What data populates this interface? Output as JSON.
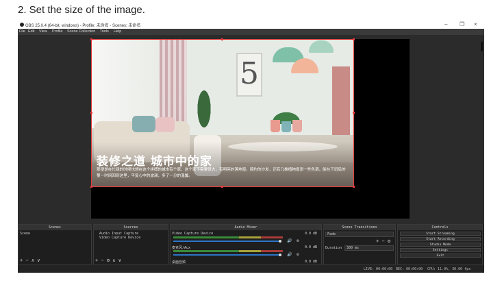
{
  "caption": "2. Set the size of the image.",
  "window": {
    "title": "OBS 25.0.4 (64-bit, windows) - Profile: 未命名 - Scenes: 未命名",
    "controls": {
      "minimize": "–",
      "maximize": "❐",
      "close": "×"
    }
  },
  "menu": [
    "File",
    "Edit",
    "View",
    "Profile",
    "Scene Collection",
    "Tools",
    "Help"
  ],
  "preview": {
    "headline": "装修之道 城市中的家",
    "description": "那便是在忙碌的时候也想在这个拼搏的城市有个家，这个家不需要很大，有明亮的落地窗，简约的沙发，还有几株植物增添一些色调，能在下班后的第一时间回到这里，平复心中的波澜，多了一分的温馨。",
    "frame_numeral": "5"
  },
  "docks": {
    "scenes": {
      "header": "Scenes",
      "items": [
        "Scene"
      ],
      "toolbar": "+ − ∧ ∨"
    },
    "sources": {
      "header": "Sources",
      "items": [
        "Audio Input Capture",
        "Video Capture Device"
      ],
      "toolbar": "+ − ⚙ ∧ ∨"
    },
    "mixer": {
      "header": "Audio Mixer",
      "channels": [
        {
          "name": "Video Capture Device",
          "db": "0.0 dB",
          "level": 0.62
        },
        {
          "name": "麦克风/Aux",
          "db": "0.0 dB",
          "level": 0.62
        },
        {
          "name": "桌面音频",
          "db": "0.0 dB",
          "level": 0.62
        }
      ]
    },
    "transitions": {
      "header": "Scene Transitions",
      "type": "Fade",
      "duration_label": "Duration",
      "duration_value": "300 ms"
    },
    "controls": {
      "header": "Controls",
      "buttons": [
        "Start Streaming",
        "Start Recording",
        "Studio Mode",
        "Settings",
        "Exit"
      ]
    }
  },
  "status": {
    "live": "LIVE: 00:00:00",
    "rec": "REC: 00:00:00",
    "cpu": "CPU: 11.0%, 30.00 fps"
  },
  "colors": {
    "selection": "#e23b3b",
    "bg": "#2b2b2b",
    "slider": "#2d76c9"
  }
}
